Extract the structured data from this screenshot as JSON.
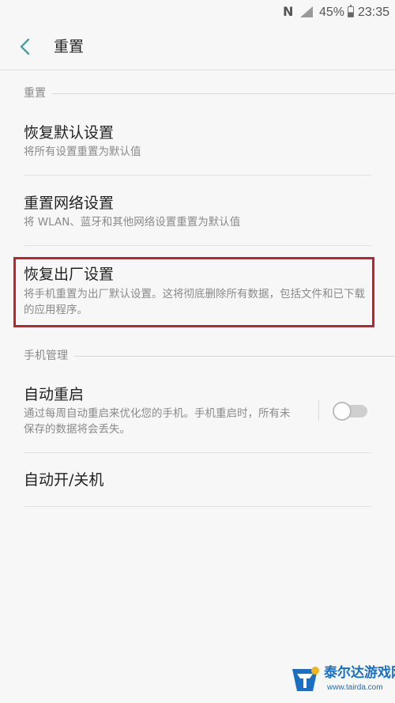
{
  "status_bar": {
    "nfc_icon": "nfc-icon",
    "signal_icon": "signal-icon",
    "battery_percent": "45%",
    "battery_icon": "battery-icon",
    "time": "23:35"
  },
  "header": {
    "back_icon": "chevron-left-icon",
    "title": "重置"
  },
  "sections": [
    {
      "label": "重置",
      "items": [
        {
          "title": "恢复默认设置",
          "description": "将所有设置重置为默认值"
        },
        {
          "title": "重置网络设置",
          "description": "将 WLAN、蓝牙和其他网络设置重置为默认值"
        },
        {
          "title": "恢复出厂设置",
          "description": "将手机重置为出厂默认设置。这将彻底删除所有数据，包括文件和已下载的应用程序。"
        }
      ]
    },
    {
      "label": "手机管理",
      "items": [
        {
          "title": "自动重启",
          "description": "通过每周自动重启来优化您的手机。手机重启时，所有未保存的数据将会丢失。",
          "toggle_on": false
        },
        {
          "title": "自动开/关机"
        }
      ]
    }
  ],
  "colors": {
    "accent": "#4a9fa0",
    "highlight": "#c7202c",
    "background": "#f7f7f7"
  },
  "watermark": {
    "name": "泰尔达游戏网",
    "url": "www.tairda.com"
  }
}
